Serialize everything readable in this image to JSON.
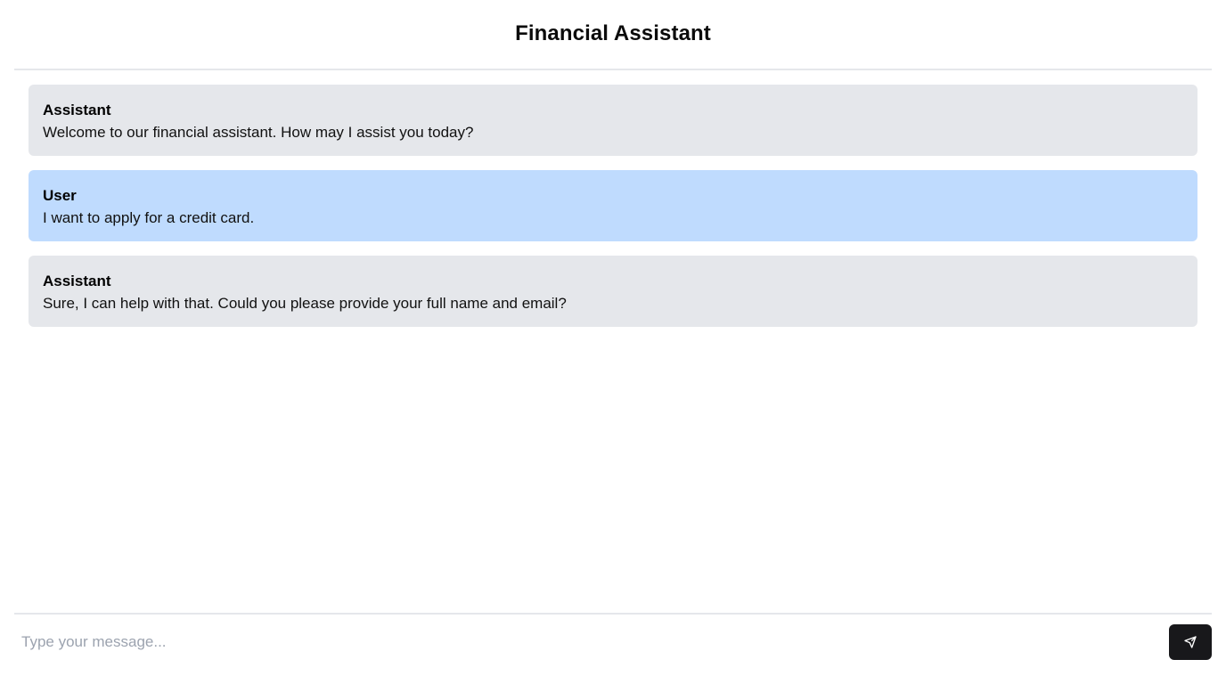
{
  "header": {
    "title": "Financial Assistant"
  },
  "messages": [
    {
      "role": "assistant",
      "sender": "Assistant",
      "text": "Welcome to our financial assistant. How may I assist you today?"
    },
    {
      "role": "user",
      "sender": "User",
      "text": "I want to apply for a credit card."
    },
    {
      "role": "assistant",
      "sender": "Assistant",
      "text": "Sure, I can help with that. Could you please provide your full name and email?"
    }
  ],
  "composer": {
    "placeholder": "Type your message...",
    "value": "",
    "send_icon": "send-icon"
  },
  "colors": {
    "assistant_bubble": "#e5e7eb",
    "user_bubble": "#bfdbfe",
    "send_button": "#18181b"
  }
}
